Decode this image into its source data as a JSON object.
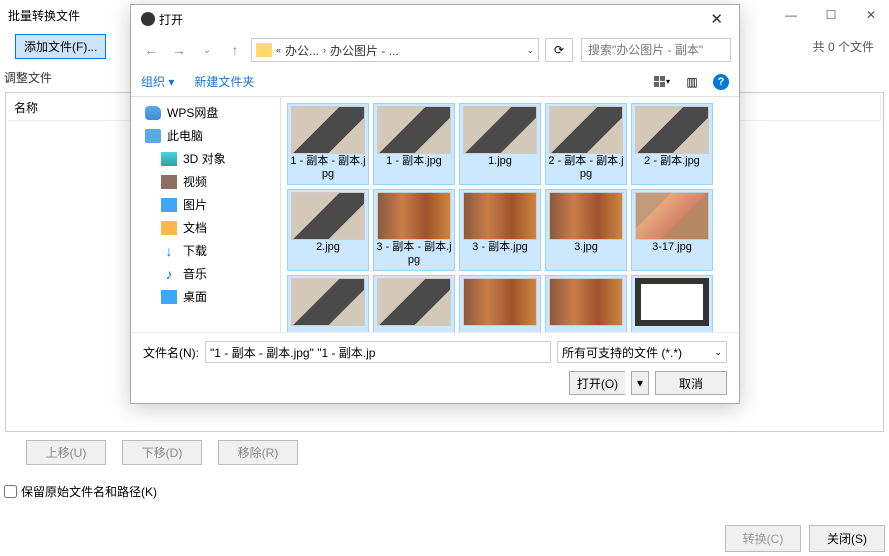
{
  "bg": {
    "title": "批量转换文件",
    "add_btn": "添加文件(F)...",
    "count_label": "共 0 个文件",
    "list_section": "调整文件",
    "col_name": "名称",
    "btn_up": "上移(U)",
    "btn_down": "下移(D)",
    "btn_remove": "移除(R)",
    "keep_path": "保留原始文件名和路径(K)",
    "convert": "转换(C)",
    "close": "关闭(S)"
  },
  "dialog": {
    "title": "打开",
    "breadcrumb": {
      "p1": "办公...",
      "p2": "办公图片 - ..."
    },
    "search_placeholder": "搜索\"办公图片 - 副本\"",
    "tb_organize": "组织",
    "tb_newfolder": "新建文件夹",
    "sidebar": [
      {
        "icon": "cloud",
        "label": "WPS网盘"
      },
      {
        "icon": "pc",
        "label": "此电脑"
      },
      {
        "icon": "cube",
        "label": "3D 对象",
        "indent": true
      },
      {
        "icon": "video",
        "label": "视频",
        "indent": true
      },
      {
        "icon": "pic",
        "label": "图片",
        "indent": true
      },
      {
        "icon": "doc",
        "label": "文档",
        "indent": true
      },
      {
        "icon": "dl",
        "label": "下载",
        "indent": true
      },
      {
        "icon": "music",
        "label": "音乐",
        "indent": true
      },
      {
        "icon": "desk",
        "label": "桌面",
        "indent": true
      }
    ],
    "files": [
      {
        "name": "1 - 副本 - 副本.jpg",
        "thumb": "laptop",
        "sel": true
      },
      {
        "name": "1 - 副本.jpg",
        "thumb": "laptop",
        "sel": true
      },
      {
        "name": "1.jpg",
        "thumb": "laptop",
        "sel": true
      },
      {
        "name": "2 - 副本 - 副本.jpg",
        "thumb": "laptop",
        "sel": true
      },
      {
        "name": "2 - 副本.jpg",
        "thumb": "laptop",
        "sel": true
      },
      {
        "name": "2.jpg",
        "thumb": "laptop",
        "sel": true
      },
      {
        "name": "3 - 副本 - 副本.jpg",
        "thumb": "books",
        "sel": true
      },
      {
        "name": "3 - 副本.jpg",
        "thumb": "books",
        "sel": true
      },
      {
        "name": "3.jpg",
        "thumb": "books",
        "sel": true
      },
      {
        "name": "3-17.jpg",
        "thumb": "person",
        "sel": true
      },
      {
        "name": "",
        "thumb": "laptop",
        "sel": true
      },
      {
        "name": "",
        "thumb": "laptop",
        "sel": true
      },
      {
        "name": "",
        "thumb": "books",
        "sel": true
      },
      {
        "name": "",
        "thumb": "books",
        "sel": true
      },
      {
        "name": "",
        "thumb": "frame",
        "sel": true
      }
    ],
    "filename_label": "文件名(N):",
    "filename_value": "\"1 - 副本 - 副本.jpg\" \"1 - 副本.jp",
    "filter": "所有可支持的文件 (*.*)",
    "open_btn": "打开(O)",
    "cancel_btn": "取消"
  }
}
